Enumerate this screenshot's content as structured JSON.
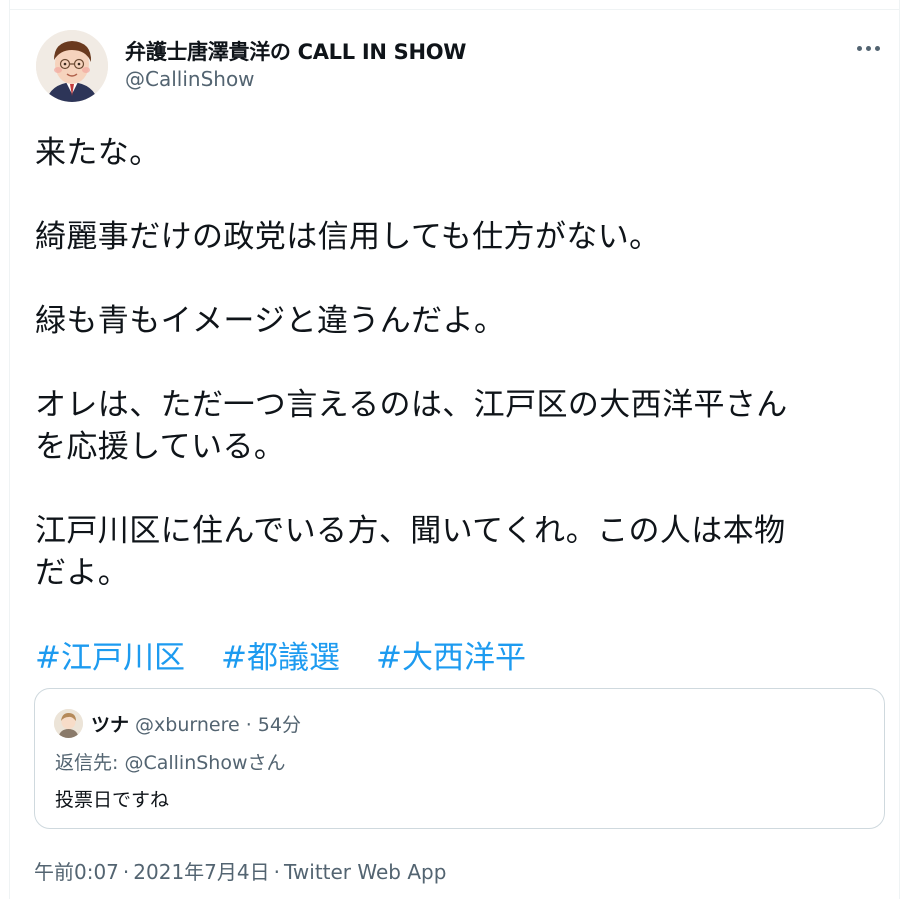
{
  "author": {
    "name": "弁護士唐澤貴洋の CALL IN SHOW",
    "handle": "@CallinShow"
  },
  "tweet": {
    "text": "来たな。\n\n綺麗事だけの政党は信用しても仕方がない。\n\n緑も青もイメージと違うんだよ。\n\nオレは、ただ一つ言えるのは、江戸区の大西洋平さん\nを応援している。\n\n江戸川区に住んでいる方、聞いてくれ。この人は本物\nだよ。",
    "hashtags": [
      "#江戸川区",
      "#都議選",
      "#大西洋平"
    ]
  },
  "quote": {
    "name": "ツナ",
    "meta": "@xburnere · 54分",
    "reply_prefix": "返信先:",
    "reply_handle": "@CallinShow",
    "reply_suffix": "さん",
    "text": "投票日ですね"
  },
  "footer": {
    "time": "午前0:07",
    "sep1": "·",
    "date": "2021年7月4日",
    "sep2": "·",
    "source": "Twitter Web App"
  },
  "colors": {
    "link": "#1d9bf0",
    "secondary_text": "#536471",
    "border": "#cfd9de"
  }
}
